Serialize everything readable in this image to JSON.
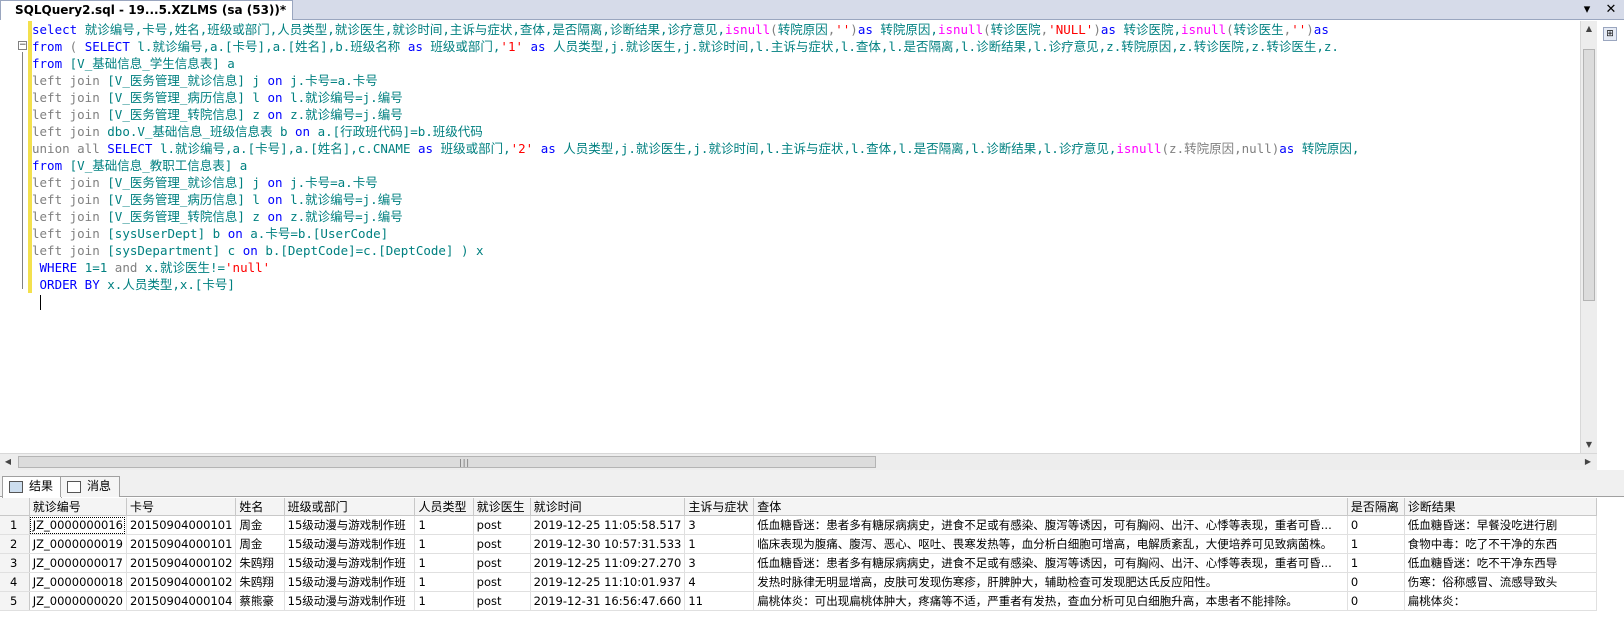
{
  "tab": {
    "title": "SQLQuery2.sql - 19...5.XZLMS (sa (53))*"
  },
  "code_lines": [
    [
      {
        "t": "select ",
        "c": "kw"
      },
      {
        "t": "就诊编号,卡号,姓名,班级或部门,人员类型,就诊医生,就诊时间,主诉与症状,查体,是否隔离,诊断结果,诊疗意见,",
        "c": "cn"
      },
      {
        "t": "isnull",
        "c": "fn"
      },
      {
        "t": "(",
        "c": "gr"
      },
      {
        "t": "转院原因",
        "c": "cn"
      },
      {
        "t": ",",
        "c": "gr"
      },
      {
        "t": "''",
        "c": "str"
      },
      {
        "t": ")",
        "c": "gr"
      },
      {
        "t": "as ",
        "c": "kw"
      },
      {
        "t": "转院原因,",
        "c": "cn"
      },
      {
        "t": "isnull",
        "c": "fn"
      },
      {
        "t": "(",
        "c": "gr"
      },
      {
        "t": "转诊医院",
        "c": "cn"
      },
      {
        "t": ",",
        "c": "gr"
      },
      {
        "t": "'NULL'",
        "c": "str"
      },
      {
        "t": ")",
        "c": "gr"
      },
      {
        "t": "as ",
        "c": "kw"
      },
      {
        "t": "转诊医院,",
        "c": "cn"
      },
      {
        "t": "isnull",
        "c": "fn"
      },
      {
        "t": "(",
        "c": "gr"
      },
      {
        "t": "转诊医生",
        "c": "cn"
      },
      {
        "t": ",",
        "c": "gr"
      },
      {
        "t": "''",
        "c": "str"
      },
      {
        "t": ")",
        "c": "gr"
      },
      {
        "t": "as",
        "c": "kw"
      }
    ],
    [
      {
        "t": "from ",
        "c": "kw"
      },
      {
        "t": "( ",
        "c": "gr"
      },
      {
        "t": "SELECT ",
        "c": "kw"
      },
      {
        "t": "l.就诊编号,a.[卡号],a.[姓名],b.班级名称 ",
        "c": "cn"
      },
      {
        "t": "as ",
        "c": "kw"
      },
      {
        "t": "班级或部门,",
        "c": "cn"
      },
      {
        "t": "'1' ",
        "c": "str"
      },
      {
        "t": "as ",
        "c": "kw"
      },
      {
        "t": "人员类型,j.就诊医生,j.就诊时间,l.主诉与症状,l.查体,l.是否隔离,l.诊断结果,l.诊疗意见,z.转院原因,z.转诊医院,z.转诊医生,z.",
        "c": "cn"
      }
    ],
    [
      {
        "t": "from ",
        "c": "kw"
      },
      {
        "t": "[V_基础信息_学生信息表] a",
        "c": "cn"
      }
    ],
    [
      {
        "t": "left join ",
        "c": "gr"
      },
      {
        "t": "[V_医务管理_就诊信息] j ",
        "c": "cn"
      },
      {
        "t": "on ",
        "c": "kw"
      },
      {
        "t": "j.卡号=a.卡号",
        "c": "cn"
      }
    ],
    [
      {
        "t": "left join ",
        "c": "gr"
      },
      {
        "t": "[V_医务管理_病历信息] l ",
        "c": "cn"
      },
      {
        "t": "on ",
        "c": "kw"
      },
      {
        "t": "l.就诊编号=j.编号",
        "c": "cn"
      }
    ],
    [
      {
        "t": "left join ",
        "c": "gr"
      },
      {
        "t": "[V_医务管理_转院信息] z ",
        "c": "cn"
      },
      {
        "t": "on ",
        "c": "kw"
      },
      {
        "t": "z.就诊编号=j.编号",
        "c": "cn"
      }
    ],
    [
      {
        "t": "left join ",
        "c": "gr"
      },
      {
        "t": "dbo.V_基础信息_班级信息表 b ",
        "c": "cn"
      },
      {
        "t": "on ",
        "c": "kw"
      },
      {
        "t": "a.[行政班代码]=b.班级代码",
        "c": "cn"
      }
    ],
    [
      {
        "t": "union all ",
        "c": "gr"
      },
      {
        "t": "SELECT ",
        "c": "kw"
      },
      {
        "t": "l.就诊编号,a.[卡号],a.[姓名],c.CNAME ",
        "c": "cn"
      },
      {
        "t": "as ",
        "c": "kw"
      },
      {
        "t": "班级或部门,",
        "c": "cn"
      },
      {
        "t": "'2' ",
        "c": "str"
      },
      {
        "t": "as ",
        "c": "kw"
      },
      {
        "t": "人员类型,j.就诊医生,j.就诊时间,l.主诉与症状,l.查体,l.是否隔离,l.诊断结果,l.诊疗意见,",
        "c": "cn"
      },
      {
        "t": "isnull",
        "c": "fn"
      },
      {
        "t": "(z.转院原因,null)",
        "c": "gr"
      },
      {
        "t": "as ",
        "c": "kw"
      },
      {
        "t": "转院原因,",
        "c": "cn"
      }
    ],
    [
      {
        "t": "from ",
        "c": "kw"
      },
      {
        "t": "[V_基础信息_教职工信息表] a",
        "c": "cn"
      }
    ],
    [
      {
        "t": "left join ",
        "c": "gr"
      },
      {
        "t": "[V_医务管理_就诊信息] j ",
        "c": "cn"
      },
      {
        "t": "on ",
        "c": "kw"
      },
      {
        "t": "j.卡号=a.卡号",
        "c": "cn"
      }
    ],
    [
      {
        "t": "left join ",
        "c": "gr"
      },
      {
        "t": "[V_医务管理_病历信息] l ",
        "c": "cn"
      },
      {
        "t": "on ",
        "c": "kw"
      },
      {
        "t": "l.就诊编号=j.编号",
        "c": "cn"
      }
    ],
    [
      {
        "t": "left join ",
        "c": "gr"
      },
      {
        "t": "[V_医务管理_转院信息] z ",
        "c": "cn"
      },
      {
        "t": "on ",
        "c": "kw"
      },
      {
        "t": "z.就诊编号=j.编号",
        "c": "cn"
      }
    ],
    [
      {
        "t": "left join ",
        "c": "gr"
      },
      {
        "t": "[sysUserDept] b ",
        "c": "cn"
      },
      {
        "t": "on ",
        "c": "kw"
      },
      {
        "t": "a.卡号=b.[UserCode]",
        "c": "cn"
      }
    ],
    [
      {
        "t": "left join ",
        "c": "gr"
      },
      {
        "t": "[sysDepartment] c ",
        "c": "cn"
      },
      {
        "t": "on ",
        "c": "kw"
      },
      {
        "t": "b.[DeptCode]=c.[DeptCode] ) x",
        "c": "cn"
      }
    ],
    [
      {
        "t": " WHERE ",
        "c": "kw"
      },
      {
        "t": "1=1 ",
        "c": "cn"
      },
      {
        "t": "and ",
        "c": "gr"
      },
      {
        "t": "x.就诊医生!=",
        "c": "cn"
      },
      {
        "t": "'null'",
        "c": "str"
      }
    ],
    [
      {
        "t": " ORDER BY ",
        "c": "kw"
      },
      {
        "t": "x.人员类型,x.[卡号]",
        "c": "cn"
      }
    ]
  ],
  "results_tabs": {
    "results": "结果",
    "messages": "消息"
  },
  "grid": {
    "columns": [
      "就诊编号",
      "卡号",
      "姓名",
      "班级或部门",
      "人员类型",
      "就诊医生",
      "就诊时间",
      "主诉与症状",
      "查体",
      "是否隔离",
      "诊断结果"
    ],
    "rows": [
      [
        "1",
        "JZ_0000000016",
        "20150904000101",
        "周金",
        "15级动漫与游戏制作班",
        "1",
        "post",
        "2019-12-25 11:05:58.517",
        "3",
        "低血糖昏迷：患者多有糖尿病病史，进食不足或有感染、腹泻等诱因，可有胸闷、出汗、心悸等表现，重者可昏...",
        "0",
        "低血糖昏迷：早餐没吃进行剧"
      ],
      [
        "2",
        "JZ_0000000019",
        "20150904000101",
        "周金",
        "15级动漫与游戏制作班",
        "1",
        "post",
        "2019-12-30 10:57:31.533",
        "1",
        "临床表现为腹痛、腹泻、恶心、呕吐、畏寒发热等，血分析白细胞可增高，电解质紊乱，大便培养可见致病菌株。",
        "1",
        "食物中毒：吃了不干净的东西"
      ],
      [
        "3",
        "JZ_0000000017",
        "20150904000102",
        "朱鸥翔",
        "15级动漫与游戏制作班",
        "1",
        "post",
        "2019-12-25 11:09:27.270",
        "3",
        "低血糖昏迷：患者多有糖尿病病史，进食不足或有感染、腹泻等诱因，可有胸闷、出汗、心悸等表现，重者可昏...",
        "1",
        "低血糖昏迷：吃不干净东西导"
      ],
      [
        "4",
        "JZ_0000000018",
        "20150904000102",
        "朱鸥翔",
        "15级动漫与游戏制作班",
        "1",
        "post",
        "2019-12-25 11:10:01.937",
        "4",
        "发热时脉律无明显增高，皮肤可发现伤寒疹，肝脾肿大，辅助检查可发现肥达氏反应阳性。",
        "0",
        "伤寒：俗称感冒、流感导致头"
      ],
      [
        "5",
        "JZ_0000000020",
        "20150904000104",
        "蔡熊豪",
        "15级动漫与游戏制作班",
        "1",
        "post",
        "2019-12-31 16:56:47.660",
        "11",
        "扁桃体炎：可出现扁桃体肿大，疼痛等不适，严重者有发热，查血分析可见白细胞升高，本患者不能排除。",
        "0",
        "扁桃体炎："
      ]
    ]
  },
  "icons": [
    "close-icon",
    "pin-icon",
    "results-grid-icon",
    "messages-icon",
    "scroll-up-icon",
    "scroll-down-icon",
    "scroll-left-icon",
    "scroll-right-icon"
  ]
}
